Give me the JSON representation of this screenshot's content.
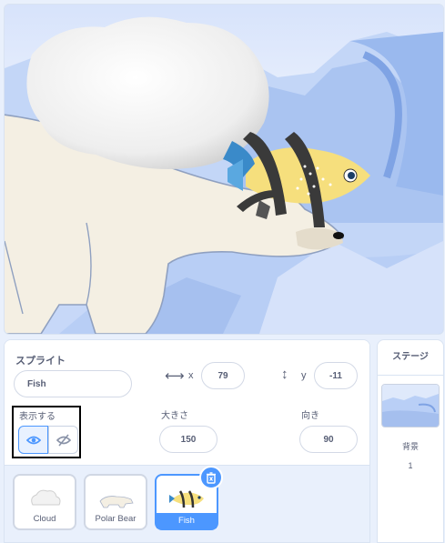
{
  "sprite_panel": {
    "heading": "スプライト",
    "name_value": "Fish",
    "x_label": "x",
    "x_value": "79",
    "y_label": "y",
    "y_value": "-11",
    "show_label": "表示する",
    "size_label": "大きさ",
    "size_value": "150",
    "direction_label": "向き",
    "direction_value": "90"
  },
  "sprites": [
    {
      "name": "Cloud",
      "selected": false
    },
    {
      "name": "Polar Bear",
      "selected": false
    },
    {
      "name": "Fish",
      "selected": true
    }
  ],
  "stage_panel": {
    "heading": "ステージ",
    "backdrop_label": "背景",
    "backdrop_count": "1"
  },
  "colors": {
    "accent": "#4c97ff",
    "text": "#575e75",
    "panel_bg": "#e9f0fc"
  },
  "icons": [
    "eye-icon",
    "eye-off-icon",
    "trash-icon",
    "horizontal-arrows-icon",
    "vertical-arrows-icon"
  ]
}
